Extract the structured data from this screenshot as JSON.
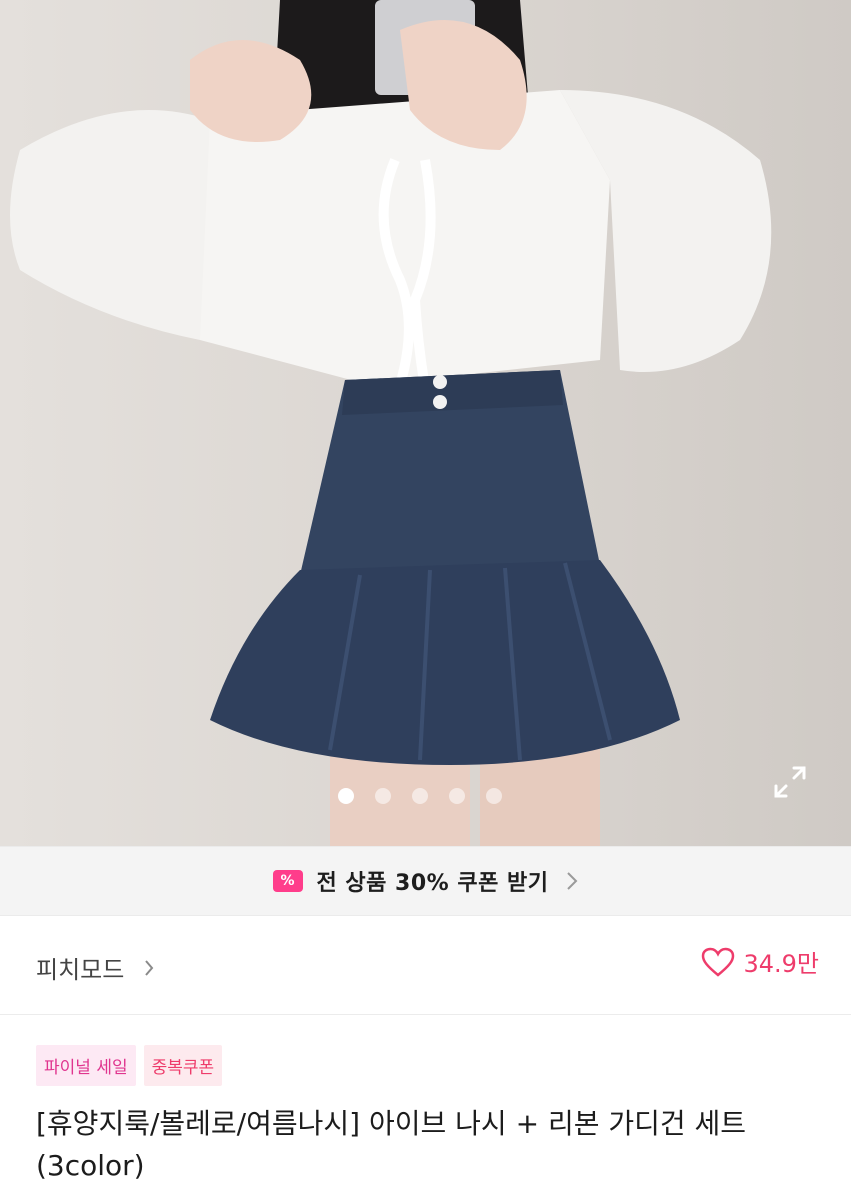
{
  "gallery": {
    "image_alt": "product photo",
    "slide_count": 5,
    "active_slide": 1,
    "expand_icon": "expand-icon",
    "colors": {
      "background": "#dcd7d3",
      "denim": "#334460",
      "blouse": "#f6f5f3",
      "hair": "#1c1a1b"
    }
  },
  "coupon": {
    "icon": "coupon-icon",
    "icon_glyph": "%",
    "label": "전 상품 30% 쿠폰 받기",
    "accent": "#ff3d8b"
  },
  "store": {
    "name": "피치모드",
    "like_icon": "heart-icon",
    "like_count": "34.9만",
    "like_color": "#ee3c6b"
  },
  "badges": [
    {
      "label": "파이널 세일"
    },
    {
      "label": "중복쿠폰"
    }
  ],
  "product": {
    "title": "[휴양지룩/볼레로/여름나시] 아이브 나시 + 리본 가디건 세트 (3color)"
  }
}
